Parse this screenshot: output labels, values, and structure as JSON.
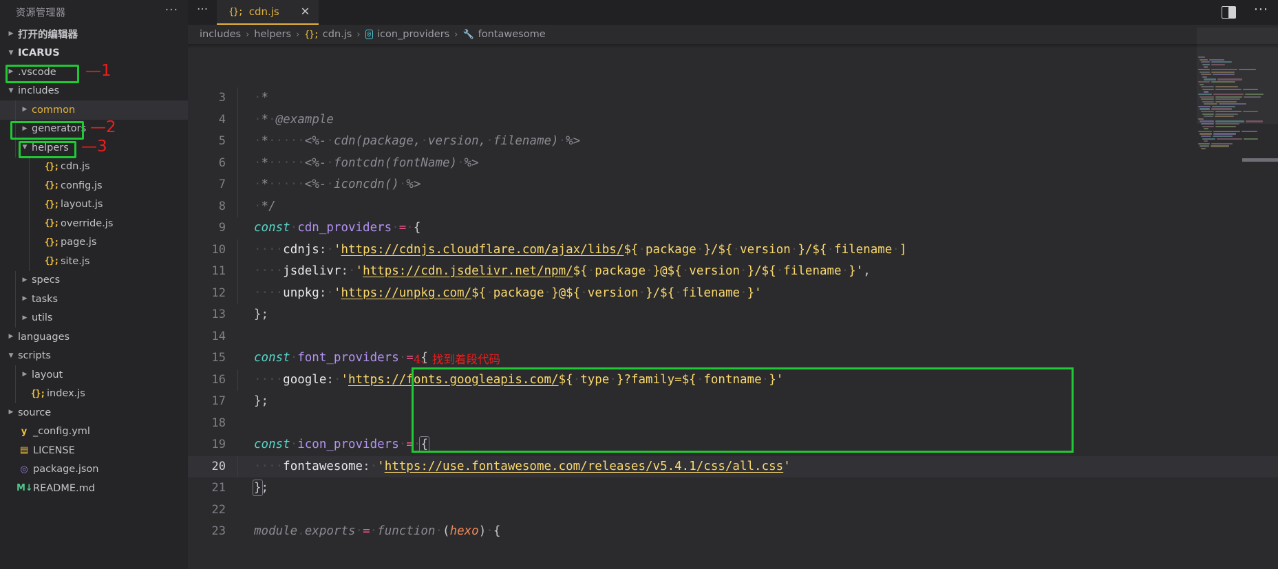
{
  "sidebar": {
    "title": "资源管理器",
    "more_label": "···",
    "sections": [
      {
        "label": "打开的编辑器",
        "twisty": "collapsed",
        "level": 0,
        "kind": "section"
      },
      {
        "label": "ICARUS",
        "twisty": "expanded",
        "level": 0,
        "kind": "root"
      }
    ],
    "tree": [
      {
        "label": ".vscode",
        "twisty": "collapsed",
        "indent": 1,
        "icon": "folder",
        "highlight": false
      },
      {
        "label": "includes",
        "twisty": "expanded",
        "indent": 1,
        "icon": "folder",
        "highlight": false,
        "box": 1
      },
      {
        "label": "common",
        "twisty": "collapsed",
        "indent": 2,
        "icon": "folder",
        "highlight": true,
        "color": "common"
      },
      {
        "label": "generators",
        "twisty": "collapsed",
        "indent": 2,
        "icon": "folder",
        "highlight": false
      },
      {
        "label": "helpers",
        "twisty": "expanded",
        "indent": 2,
        "icon": "folder",
        "highlight": false,
        "box": 2
      },
      {
        "label": "cdn.js",
        "twisty": "none",
        "indent": 3,
        "icon": "js",
        "highlight": false,
        "box": 3
      },
      {
        "label": "config.js",
        "twisty": "none",
        "indent": 3,
        "icon": "js",
        "highlight": false
      },
      {
        "label": "layout.js",
        "twisty": "none",
        "indent": 3,
        "icon": "js",
        "highlight": false
      },
      {
        "label": "override.js",
        "twisty": "none",
        "indent": 3,
        "icon": "js",
        "highlight": false
      },
      {
        "label": "page.js",
        "twisty": "none",
        "indent": 3,
        "icon": "js",
        "highlight": false
      },
      {
        "label": "site.js",
        "twisty": "none",
        "indent": 3,
        "icon": "js",
        "highlight": false
      },
      {
        "label": "specs",
        "twisty": "collapsed",
        "indent": 2,
        "icon": "folder",
        "highlight": false
      },
      {
        "label": "tasks",
        "twisty": "collapsed",
        "indent": 2,
        "icon": "folder",
        "highlight": false
      },
      {
        "label": "utils",
        "twisty": "collapsed",
        "indent": 2,
        "icon": "folder",
        "highlight": false
      },
      {
        "label": "languages",
        "twisty": "collapsed",
        "indent": 1,
        "icon": "folder",
        "highlight": false
      },
      {
        "label": "scripts",
        "twisty": "expanded",
        "indent": 1,
        "icon": "folder",
        "highlight": false
      },
      {
        "label": "layout",
        "twisty": "collapsed",
        "indent": 2,
        "icon": "folder",
        "highlight": false
      },
      {
        "label": "index.js",
        "twisty": "none",
        "indent": 2,
        "icon": "js",
        "highlight": false
      },
      {
        "label": "source",
        "twisty": "collapsed",
        "indent": 1,
        "icon": "folder",
        "highlight": false
      },
      {
        "label": "_config.yml",
        "twisty": "none",
        "indent": 1,
        "icon": "yml",
        "highlight": false
      },
      {
        "label": "LICENSE",
        "twisty": "none",
        "indent": 1,
        "icon": "license",
        "highlight": false
      },
      {
        "label": "package.json",
        "twisty": "none",
        "indent": 1,
        "icon": "json",
        "highlight": false
      },
      {
        "label": "README.md",
        "twisty": "none",
        "indent": 1,
        "icon": "md",
        "highlight": false
      }
    ]
  },
  "annotations": {
    "marks": [
      {
        "id": 1,
        "text": "—1"
      },
      {
        "id": 2,
        "text": "—2"
      },
      {
        "id": 3,
        "text": "—3"
      }
    ],
    "code_note": "4、找到着段代码",
    "box_color": "#1fc933",
    "mark_color": "#ef1d1d"
  },
  "tabbar": {
    "overflow_label": "···",
    "tabs": [
      {
        "label": "cdn.js",
        "icon": "js-icon",
        "close": "✕",
        "active": true
      }
    ],
    "split_editor_label": "split-editor",
    "more_actions_label": "···"
  },
  "breadcrumb": {
    "separator": "›",
    "items": [
      {
        "label": "includes",
        "icon": "none"
      },
      {
        "label": "helpers",
        "icon": "none"
      },
      {
        "label": "cdn.js",
        "icon": "js"
      },
      {
        "label": "icon_providers",
        "icon": "symbol-object"
      },
      {
        "label": "fontawesome",
        "icon": "symbol-property"
      }
    ]
  },
  "editor": {
    "first_line": 3,
    "current_line": 20,
    "lines": [
      {
        "n": 3,
        "tokens": [
          {
            "t": "·",
            "c": "dot"
          },
          {
            "t": "*",
            "c": "cm"
          }
        ]
      },
      {
        "n": 4,
        "tokens": [
          {
            "t": "·",
            "c": "dot"
          },
          {
            "t": "*",
            "c": "cm"
          },
          {
            "t": "·",
            "c": "dot"
          },
          {
            "t": "@example",
            "c": "cm"
          }
        ]
      },
      {
        "n": 5,
        "tokens": [
          {
            "t": "·",
            "c": "dot"
          },
          {
            "t": "*",
            "c": "cm"
          },
          {
            "t": "·····",
            "c": "dot"
          },
          {
            "t": "<%-",
            "c": "cm"
          },
          {
            "t": "·",
            "c": "dot"
          },
          {
            "t": "cdn(package,",
            "c": "cm"
          },
          {
            "t": "·",
            "c": "dot"
          },
          {
            "t": "version,",
            "c": "cm"
          },
          {
            "t": "·",
            "c": "dot"
          },
          {
            "t": "filename)",
            "c": "cm"
          },
          {
            "t": "·",
            "c": "dot"
          },
          {
            "t": "%>",
            "c": "cm"
          }
        ]
      },
      {
        "n": 6,
        "tokens": [
          {
            "t": "·",
            "c": "dot"
          },
          {
            "t": "*",
            "c": "cm"
          },
          {
            "t": "·····",
            "c": "dot"
          },
          {
            "t": "<%-",
            "c": "cm"
          },
          {
            "t": "·",
            "c": "dot"
          },
          {
            "t": "fontcdn(fontName)",
            "c": "cm"
          },
          {
            "t": "·",
            "c": "dot"
          },
          {
            "t": "%>",
            "c": "cm"
          }
        ]
      },
      {
        "n": 7,
        "tokens": [
          {
            "t": "·",
            "c": "dot"
          },
          {
            "t": "*",
            "c": "cm"
          },
          {
            "t": "·····",
            "c": "dot"
          },
          {
            "t": "<%-",
            "c": "cm"
          },
          {
            "t": "·",
            "c": "dot"
          },
          {
            "t": "iconcdn()",
            "c": "cm"
          },
          {
            "t": "·",
            "c": "dot"
          },
          {
            "t": "%>",
            "c": "cm"
          }
        ]
      },
      {
        "n": 8,
        "tokens": [
          {
            "t": "·",
            "c": "dot"
          },
          {
            "t": "*/",
            "c": "cm"
          }
        ]
      },
      {
        "n": 9,
        "tokens": [
          {
            "t": "const",
            "c": "k"
          },
          {
            "t": "·",
            "c": "dot"
          },
          {
            "t": "cdn_providers",
            "c": "var"
          },
          {
            "t": "·",
            "c": "dot"
          },
          {
            "t": "=",
            "c": "op"
          },
          {
            "t": "·",
            "c": "dot"
          },
          {
            "t": "{",
            "c": "pn"
          }
        ]
      },
      {
        "n": 10,
        "tokens": [
          {
            "t": "····",
            "c": "dot"
          },
          {
            "t": "cdnjs",
            "c": "prop"
          },
          {
            "t": ":",
            "c": "pn"
          },
          {
            "t": "·",
            "c": "dot"
          },
          {
            "t": "'",
            "c": "str"
          },
          {
            "t": "https://cdnjs.cloudflare.com/ajax/libs/",
            "c": "stru"
          },
          {
            "t": "${",
            "c": "str"
          },
          {
            "t": "·",
            "c": "dot"
          },
          {
            "t": "package",
            "c": "str"
          },
          {
            "t": "·",
            "c": "dot"
          },
          {
            "t": "}/${",
            "c": "str"
          },
          {
            "t": "·",
            "c": "dot"
          },
          {
            "t": "version",
            "c": "str"
          },
          {
            "t": "·",
            "c": "dot"
          },
          {
            "t": "}/${",
            "c": "str"
          },
          {
            "t": "·",
            "c": "dot"
          },
          {
            "t": "filename",
            "c": "str"
          },
          {
            "t": "·",
            "c": "dot"
          },
          {
            "t": "]",
            "c": "str"
          }
        ]
      },
      {
        "n": 11,
        "tokens": [
          {
            "t": "····",
            "c": "dot"
          },
          {
            "t": "jsdelivr",
            "c": "prop"
          },
          {
            "t": ":",
            "c": "pn"
          },
          {
            "t": "·",
            "c": "dot"
          },
          {
            "t": "'",
            "c": "str"
          },
          {
            "t": "https://cdn.jsdelivr.net/npm/",
            "c": "stru"
          },
          {
            "t": "${",
            "c": "str"
          },
          {
            "t": "·",
            "c": "dot"
          },
          {
            "t": "package",
            "c": "str"
          },
          {
            "t": "·",
            "c": "dot"
          },
          {
            "t": "}@${",
            "c": "str"
          },
          {
            "t": "·",
            "c": "dot"
          },
          {
            "t": "version",
            "c": "str"
          },
          {
            "t": "·",
            "c": "dot"
          },
          {
            "t": "}/${",
            "c": "str"
          },
          {
            "t": "·",
            "c": "dot"
          },
          {
            "t": "filename",
            "c": "str"
          },
          {
            "t": "·",
            "c": "dot"
          },
          {
            "t": "}'",
            "c": "str"
          },
          {
            "t": ",",
            "c": "pn"
          }
        ]
      },
      {
        "n": 12,
        "tokens": [
          {
            "t": "····",
            "c": "dot"
          },
          {
            "t": "unpkg",
            "c": "prop"
          },
          {
            "t": ":",
            "c": "pn"
          },
          {
            "t": "·",
            "c": "dot"
          },
          {
            "t": "'",
            "c": "str"
          },
          {
            "t": "https://unpkg.com/",
            "c": "stru"
          },
          {
            "t": "${",
            "c": "str"
          },
          {
            "t": "·",
            "c": "dot"
          },
          {
            "t": "package",
            "c": "str"
          },
          {
            "t": "·",
            "c": "dot"
          },
          {
            "t": "}@${",
            "c": "str"
          },
          {
            "t": "·",
            "c": "dot"
          },
          {
            "t": "version",
            "c": "str"
          },
          {
            "t": "·",
            "c": "dot"
          },
          {
            "t": "}/${",
            "c": "str"
          },
          {
            "t": "·",
            "c": "dot"
          },
          {
            "t": "filename",
            "c": "str"
          },
          {
            "t": "·",
            "c": "dot"
          },
          {
            "t": "}'",
            "c": "str"
          }
        ]
      },
      {
        "n": 13,
        "tokens": [
          {
            "t": "};",
            "c": "pn"
          }
        ]
      },
      {
        "n": 14,
        "tokens": []
      },
      {
        "n": 15,
        "tokens": [
          {
            "t": "const",
            "c": "k"
          },
          {
            "t": "·",
            "c": "dot"
          },
          {
            "t": "font_providers",
            "c": "var"
          },
          {
            "t": "·",
            "c": "dot"
          },
          {
            "t": "=",
            "c": "op"
          },
          {
            "t": "·",
            "c": "dot"
          },
          {
            "t": "{",
            "c": "pn"
          }
        ]
      },
      {
        "n": 16,
        "tokens": [
          {
            "t": "····",
            "c": "dot"
          },
          {
            "t": "google",
            "c": "prop"
          },
          {
            "t": ":",
            "c": "pn"
          },
          {
            "t": "·",
            "c": "dot"
          },
          {
            "t": "'",
            "c": "str"
          },
          {
            "t": "https://fonts.googleapis.com/",
            "c": "stru"
          },
          {
            "t": "${",
            "c": "str"
          },
          {
            "t": "·",
            "c": "dot"
          },
          {
            "t": "type",
            "c": "str"
          },
          {
            "t": "·",
            "c": "dot"
          },
          {
            "t": "}?family=${",
            "c": "str"
          },
          {
            "t": "·",
            "c": "dot"
          },
          {
            "t": "fontname",
            "c": "str"
          },
          {
            "t": "·",
            "c": "dot"
          },
          {
            "t": "}'",
            "c": "str"
          }
        ]
      },
      {
        "n": 17,
        "tokens": [
          {
            "t": "};",
            "c": "pn"
          }
        ]
      },
      {
        "n": 18,
        "tokens": []
      },
      {
        "n": 19,
        "tokens": [
          {
            "t": "const",
            "c": "k"
          },
          {
            "t": "·",
            "c": "dot"
          },
          {
            "t": "icon_providers",
            "c": "var"
          },
          {
            "t": "·",
            "c": "dot"
          },
          {
            "t": "=",
            "c": "op"
          },
          {
            "t": "·",
            "c": "dot"
          },
          {
            "t": "{",
            "c": "pnbm"
          }
        ]
      },
      {
        "n": 20,
        "tokens": [
          {
            "t": "····",
            "c": "dot"
          },
          {
            "t": "fontawesome",
            "c": "prop"
          },
          {
            "t": ":",
            "c": "pn"
          },
          {
            "t": "·",
            "c": "dot"
          },
          {
            "t": "'",
            "c": "str"
          },
          {
            "t": "https://use.fontawesome.com/releases/v5.4.1/css/all.css",
            "c": "stru"
          },
          {
            "t": "'",
            "c": "str"
          }
        ]
      },
      {
        "n": 21,
        "tokens": [
          {
            "t": "}",
            "c": "pnbm"
          },
          {
            "t": ";",
            "c": "pn"
          }
        ]
      },
      {
        "n": 22,
        "tokens": []
      },
      {
        "n": 23,
        "tokens": [
          {
            "t": "module",
            "c": "cm"
          },
          {
            "t": ".",
            "c": "dot"
          },
          {
            "t": "exports",
            "c": "cm"
          },
          {
            "t": "·",
            "c": "dot"
          },
          {
            "t": "=",
            "c": "op"
          },
          {
            "t": "·",
            "c": "dot"
          },
          {
            "t": "function",
            "c": "cm"
          },
          {
            "t": "·",
            "c": "dot"
          },
          {
            "t": "(",
            "c": "pn"
          },
          {
            "t": "hexo",
            "c": "fn"
          },
          {
            "t": ")",
            "c": "pn"
          },
          {
            "t": "·",
            "c": "dot"
          },
          {
            "t": "{",
            "c": "pn"
          }
        ]
      }
    ]
  },
  "colors": {
    "editor_bg": "#2b2b2e",
    "sidebar_bg": "#252528",
    "tabbar_bg": "#212124",
    "accent": "#e8b339",
    "string": "#fbd96b",
    "keyword": "#56d6c8",
    "variable": "#b392f0",
    "operator": "#f6578c",
    "comment": "#8a8a90",
    "annotation_green": "#1fc933",
    "annotation_red": "#ef1d1d"
  }
}
